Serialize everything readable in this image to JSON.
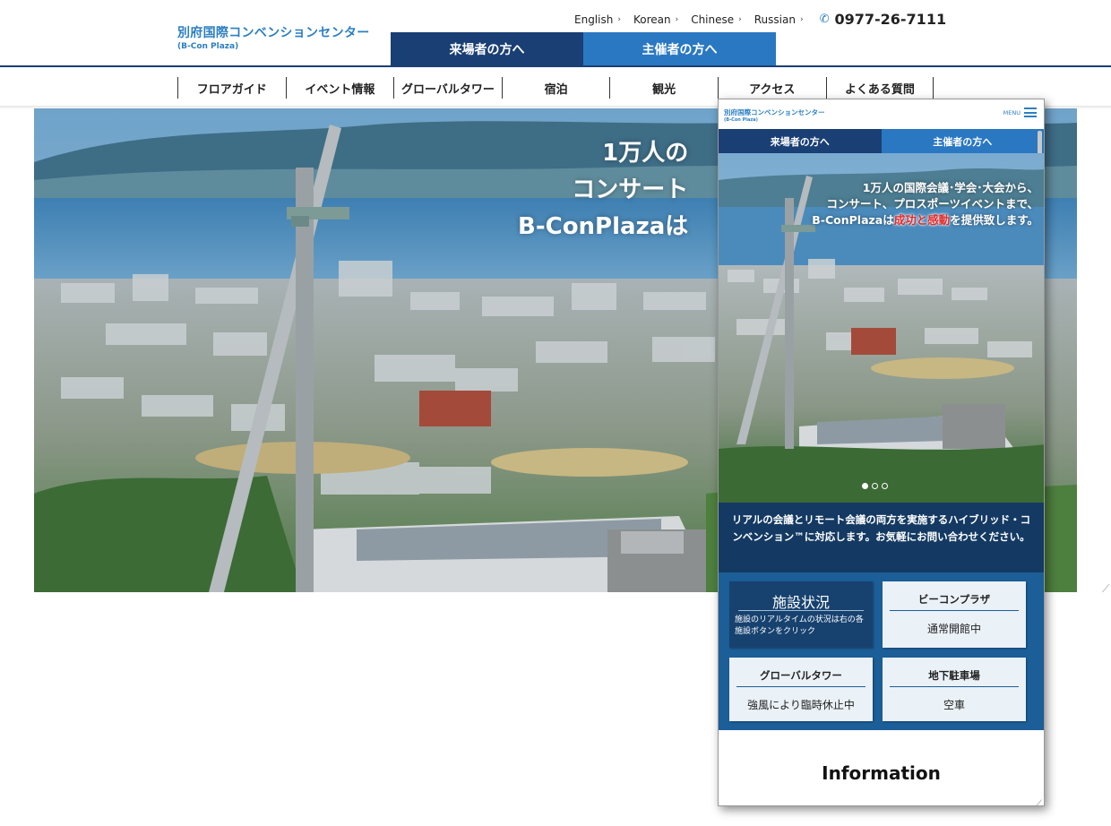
{
  "header": {
    "logo_main": "別府国際コンベンションセンター",
    "logo_sub": "(B-Con Plaza)",
    "languages": [
      {
        "label": "English"
      },
      {
        "label": "Korean"
      },
      {
        "label": "Chinese"
      },
      {
        "label": "Russian"
      }
    ],
    "phone": "0977-26-7111",
    "audience_visitor": "来場者の方へ",
    "audience_organizer": "主催者の方へ"
  },
  "nav": [
    {
      "label": "フロアガイド"
    },
    {
      "label": "イベント情報"
    },
    {
      "label": "グローバルタワー"
    },
    {
      "label": "宿泊"
    },
    {
      "label": "観光"
    },
    {
      "label": "アクセス"
    },
    {
      "label": "よくある質問"
    }
  ],
  "hero": {
    "copy_line1": "1万人の",
    "copy_line2": "コンサート",
    "copy_line3": "B-ConPlazaは"
  },
  "mobile": {
    "logo_main": "別府国際コンベンションセンター",
    "logo_sub": "(B-Con Plaza)",
    "menu_label": "MENU",
    "audience_visitor": "来場者の方へ",
    "audience_organizer": "主催者の方へ",
    "hero_line1": "1万人の国際会議･学会･大会から、",
    "hero_line2": "コンサート、プロスポーツイベントまで、",
    "hero_line3_pre": "B-ConPlazaは",
    "hero_line3_highlight": "成功と感動",
    "hero_line3_post": "を提供致します。",
    "notice": "リアルの会議とリモート会議の両方を実施するハイブリッド・コンベンション™に対応します。お気軽にお問い合わせください。",
    "status_intro_title": "施設状況",
    "status_intro_desc": "施設のリアルタイムの状況は右の各施設ボタンをクリック",
    "status": [
      {
        "title": "ビーコンプラザ",
        "value": "通常開館中"
      },
      {
        "title": "グローバルタワー",
        "value": "強風により臨時休止中"
      },
      {
        "title": "地下駐車場",
        "value": "空車"
      }
    ],
    "info_title": "Information"
  },
  "colors": {
    "brand_dark": "#1a3f75",
    "brand_light": "#2a78c2",
    "logo_blue": "#2d7fc1",
    "notice_bg": "#143a63",
    "status_bg": "#1c5e97",
    "highlight_red": "#e02a2a"
  },
  "icons": [
    "chevron-right-icon",
    "phone-icon",
    "hamburger-menu-icon"
  ]
}
